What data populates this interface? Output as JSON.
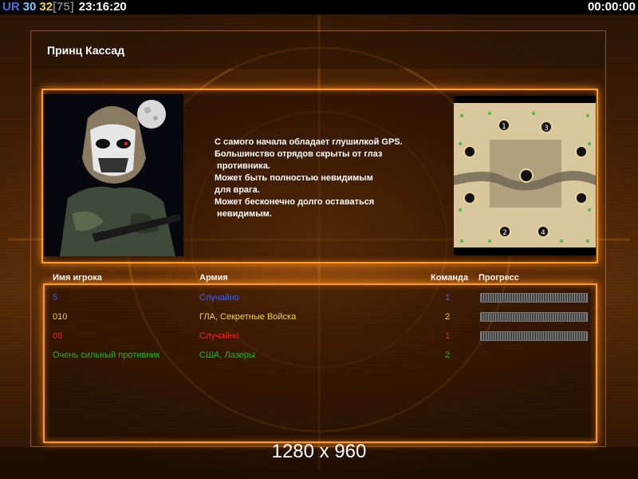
{
  "topbar": {
    "ur_label": "UR",
    "value_a": "30",
    "value_b": "32",
    "value_bracket": "[75]",
    "clock": "23:16:20",
    "timer": "00:00:00"
  },
  "title": "Принц Кассад",
  "description": [
    "С самого начала обладает глушилкой GPS.",
    "Большинство отрядов скрыты от глаз",
    " противника.",
    "Может быть полностью невидимым",
    "для врага.",
    "Может бесконечно долго оставаться",
    " невидимым."
  ],
  "map": {
    "start_positions": [
      "1",
      "2",
      "3",
      "4"
    ]
  },
  "columns": {
    "player": "Имя игрока",
    "army": "Армия",
    "team": "Команда",
    "progress": "Прогресс"
  },
  "players": [
    {
      "name": "5",
      "army": "Случайно",
      "team": "1",
      "color": "#3b5bff",
      "progress": 1.0
    },
    {
      "name": "010",
      "army": "ГЛА, Секретные Войска",
      "team": "2",
      "color": "#f0d23a",
      "progress": 1.0
    },
    {
      "name": "06",
      "army": "Случайно",
      "team": "1",
      "color": "#ff1a1a",
      "progress": 1.0
    },
    {
      "name": "Очень сильный противник",
      "army": "США, Лазеры",
      "team": "2",
      "color": "#1fb81f",
      "progress": 0.0
    }
  ],
  "resolution": "1280 x 960"
}
